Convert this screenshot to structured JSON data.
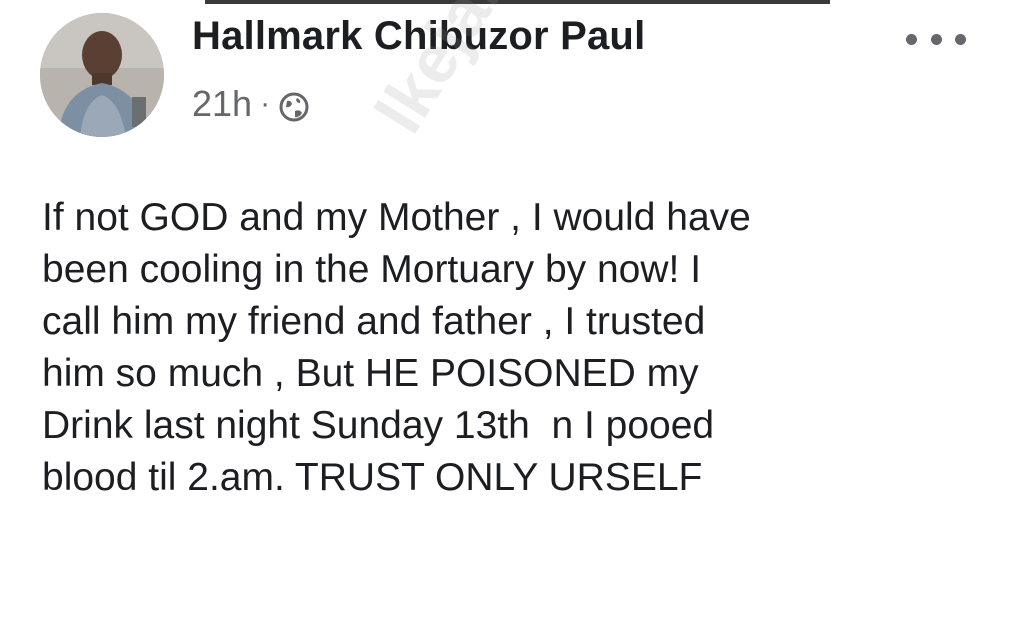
{
  "post": {
    "author": "Hallmark Chibuzor Paul",
    "timestamp": "21h",
    "separator": "·",
    "audience_icon": "globe-icon",
    "more_icon": "more-options-icon",
    "lines": [
      "If not GOD and my Mother , I would have",
      "been cooling in the Mortuary by now! I",
      "call him my friend and father , I trusted",
      "him so much , But HE POISONED my",
      "Drink last night Sunday 13th  n I pooed",
      "blood til 2.am. TRUST ONLY URSELF"
    ]
  },
  "watermark": {
    "text": "lkejabi"
  },
  "colors": {
    "text": "#1c1e21",
    "meta": "#65676b",
    "background": "#ffffff"
  }
}
